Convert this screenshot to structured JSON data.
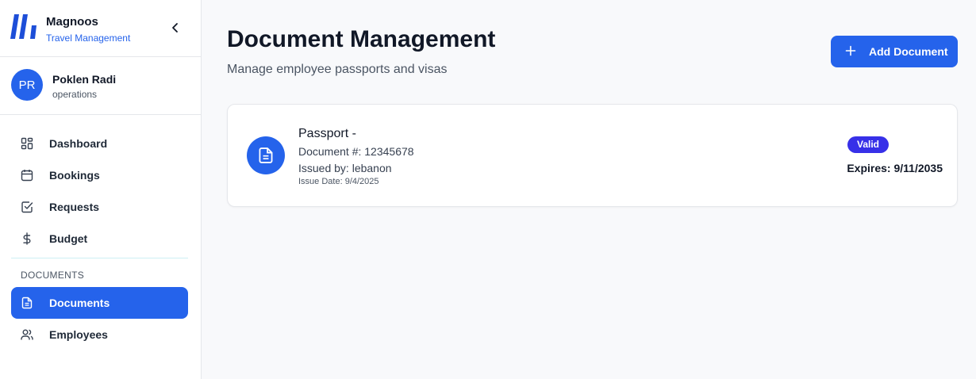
{
  "brand": {
    "name": "Magnoos",
    "subtitle": "Travel Management",
    "color": "#2563eb"
  },
  "user": {
    "initials": "PR",
    "name": "Poklen Radi",
    "role": "operations"
  },
  "nav": {
    "items": [
      {
        "label": "Dashboard",
        "icon": "dashboard-grid-icon"
      },
      {
        "label": "Bookings",
        "icon": "calendar-icon"
      },
      {
        "label": "Requests",
        "icon": "checkbox-icon"
      },
      {
        "label": "Budget",
        "icon": "dollar-icon"
      }
    ],
    "section_label": "DOCUMENTS",
    "section_items": [
      {
        "label": "Documents",
        "icon": "document-icon",
        "active": true
      },
      {
        "label": "Employees",
        "icon": "users-icon"
      }
    ]
  },
  "main": {
    "title": "Document Management",
    "subtitle": "Manage employee passports and visas",
    "add_button_label": "Add Document"
  },
  "documents": [
    {
      "title": "Passport -",
      "number": "Document #: 12345678",
      "issuer": "Issued by: lebanon",
      "issue_date": "Issue Date: 9/4/2025",
      "status": "Valid",
      "expires": "Expires: 9/11/2035"
    }
  ],
  "colors": {
    "accent": "#2563eb",
    "badge": "#3730e8"
  }
}
